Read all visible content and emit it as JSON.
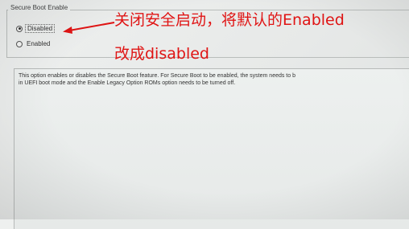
{
  "group": {
    "title": "Secure Boot Enable"
  },
  "options": [
    {
      "label": "Disabled",
      "selected": true
    },
    {
      "label": "Enabled",
      "selected": false
    }
  ],
  "annotation": {
    "line1": "关闭安全启动，将默认的Enabled",
    "line2": "改成disabled",
    "color": "#e01414"
  },
  "description": {
    "line1": "This option enables or disables the Secure Boot feature. For Secure Boot to be enabled, the system needs to b",
    "line2": "in UEFI boot mode and the Enable Legacy Option ROMs option needs to be turned off."
  }
}
